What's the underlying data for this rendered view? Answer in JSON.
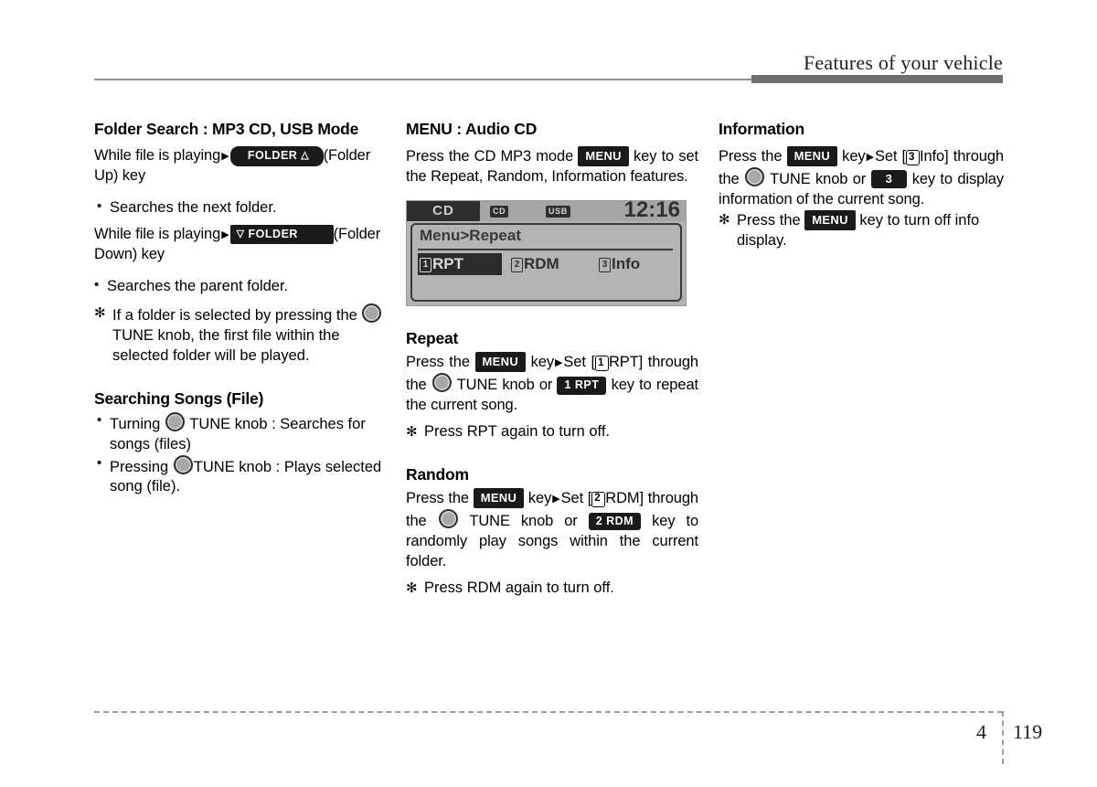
{
  "header": {
    "title": "Features of your vehicle"
  },
  "footer": {
    "chapter": "4",
    "page": "119"
  },
  "column1": {
    "title": "Folder Search : MP3 CD, USB Mode",
    "line1_pre": "While file is playing",
    "folder_up_chip": "FOLDER",
    "folder_up_icon": "chevron-up-icon",
    "line1_post": "(Folder Up) key",
    "bullet1": "Searches the next folder.",
    "line2_pre": "While file is playing",
    "folder_down_chip": "FOLDER",
    "folder_down_icon": "chevron-down-icon",
    "line2_post": "(Folder Down) key",
    "bullet2": "Searches the parent folder.",
    "note1_a": "If a folder is selected by pressing the",
    "note1_b": "TUNE knob, the first file within the selected folder will be played.",
    "subtitle2": "Searching Songs (File)",
    "bullet3_a": "Turning",
    "bullet3_b": "TUNE knob : Searches for songs (files)",
    "bullet4_a": "Pressing",
    "bullet4_b": "TUNE knob : Plays selected song (file)."
  },
  "column2": {
    "title": "MENU : Audio CD",
    "intro_a": "Press the CD MP3 mode",
    "menu_chip": "MENU",
    "intro_b": "key to set the Repeat, Random, Information features.",
    "lcd": {
      "mode": "CD",
      "badge_cd": "CD",
      "badge_usb": "USB",
      "clock": "12:16",
      "heading": "Menu>Repeat",
      "items": [
        {
          "num": "1",
          "label": "RPT",
          "selected": true
        },
        {
          "num": "2",
          "label": "RDM",
          "selected": false
        },
        {
          "num": "3",
          "label": "Info",
          "selected": false
        }
      ]
    },
    "repeat": {
      "title": "Repeat",
      "t1": "Press the",
      "menu_chip": "MENU",
      "t2": "key",
      "t3": "Set [",
      "num": "1",
      "t4": "RPT]",
      "t5": "through the",
      "t6": "TUNE knob or",
      "key_chip": "1 RPT",
      "t7": "key to repeat the current song.",
      "note": "Press RPT again to turn off."
    },
    "random": {
      "title": "Random",
      "t1": "Press the",
      "menu_chip": "MENU",
      "t2": "key",
      "t3": "Set [",
      "num": "2",
      "t4": "RDM]",
      "t5": "through the",
      "t6": "TUNE knob or",
      "key_chip": "2 RDM",
      "t7": "key to randomly play songs within the current folder.",
      "note": "Press RDM again to turn off."
    }
  },
  "column3": {
    "title": "Information",
    "t1": "Press the",
    "menu_chip": "MENU",
    "t2": "key",
    "t3": "Set [",
    "num": "3",
    "t4": "Info]",
    "t5": "through the",
    "t6": "TUNE knob or",
    "key_chip": "3",
    "t7": "key to display information of the current song.",
    "note_a": "Press the",
    "note_menu_chip": "MENU",
    "note_b": "key to turn off info display."
  }
}
